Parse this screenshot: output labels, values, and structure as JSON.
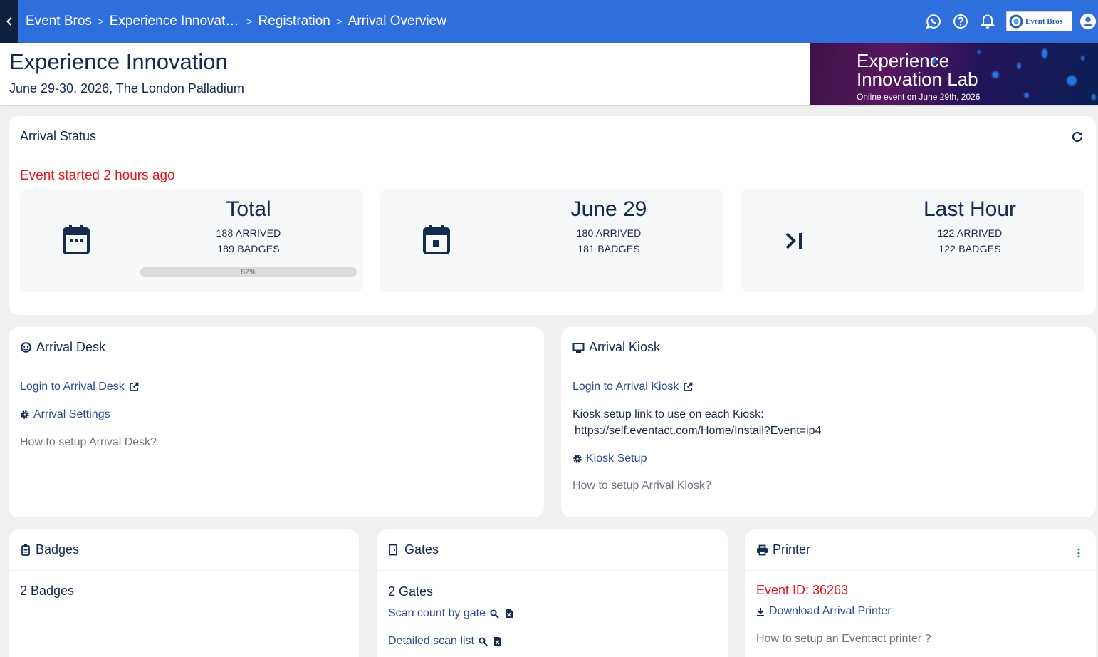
{
  "topbar": {
    "breadcrumbs": [
      "Event Bros",
      "Experience Innovation Lab",
      "Registration",
      "Arrival Overview"
    ],
    "logo_text": "Event Bros"
  },
  "header": {
    "title": "Experience Innovation",
    "subtitle": "June 29-30, 2026, The London Palladium",
    "banner_title": "Experience Innovation Lab",
    "banner_subtitle": "Online event on June 29th, 2026"
  },
  "arrival_status": {
    "title": "Arrival Status",
    "started_text": "Event started 2 hours ago",
    "cards": [
      {
        "title": "Total",
        "arrived": "188 ARRIVED",
        "badges": "189 BADGES",
        "progress_label": "82%",
        "progress": 0.82
      },
      {
        "title": "June 29",
        "arrived": "180 ARRIVED",
        "badges": "181 BADGES"
      },
      {
        "title": "Last Hour",
        "arrived": "122 ARRIVED",
        "badges": "122 BADGES"
      }
    ]
  },
  "arrival_desk": {
    "title": "Arrival Desk",
    "login_label": "Login to Arrival Desk",
    "settings_label": "Arrival Settings",
    "help_label": "How to setup Arrival Desk?"
  },
  "arrival_kiosk": {
    "title": "Arrival Kiosk",
    "login_label": "Login to Arrival Kiosk",
    "setup_text": "Kiosk setup link to use on each Kiosk:",
    "setup_url": "https://self.eventact.com/Home/Install?Event=ip4",
    "setup_label": "Kiosk Setup",
    "help_label": "How to setup Arrival Kiosk?"
  },
  "badges": {
    "title": "Badges",
    "count_label": "2 Badges"
  },
  "gates": {
    "title": "Gates",
    "count_label": "2 Gates",
    "scan_count_label": "Scan count by gate",
    "detailed_scan_label": "Detailed scan list"
  },
  "printer": {
    "title": "Printer",
    "event_id_label": "Event ID: 36263",
    "download_label": "Download Arrival Printer",
    "help_label": "How to setup an Eventact printer ?"
  },
  "colors": {
    "topbar": "#2f6fdd",
    "accent_red": "#e3161b",
    "navy": "#142a4f"
  }
}
